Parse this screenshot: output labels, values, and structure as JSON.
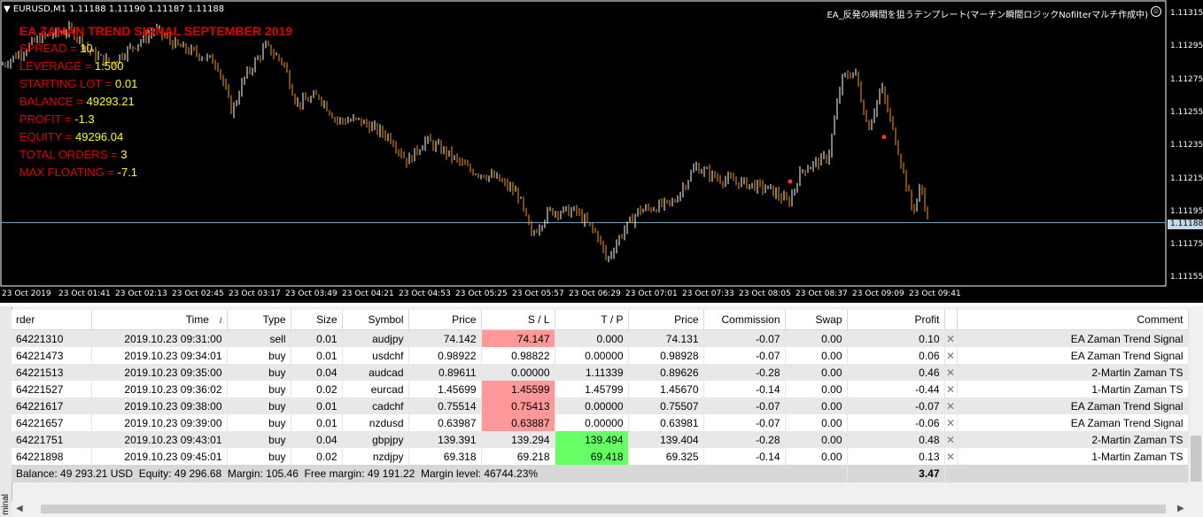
{
  "chart": {
    "symbol": "EURUSD,M1",
    "ohlc": "1.11188 1.11190 1.11187 1.11188",
    "expert_name": "EA_反発の瞬間を狙うテンプレート(マーチン瞬間ロジックNofilterマルチ作成中)",
    "expert_icon": "smiley-icon",
    "info_title": "EA ZAMAN TREND SIGNAL SEPTEMBER 2019",
    "info": [
      {
        "label": "SPREAD = ",
        "value": "10"
      },
      {
        "label": "LEVERAGE = ",
        "value": "1:500"
      },
      {
        "label": "STARTING LOT = ",
        "value": "0.01"
      },
      {
        "label": "BALANCE = ",
        "value": "49293.21"
      },
      {
        "label": "PROFIT = ",
        "value": "-1.3"
      },
      {
        "label": "EQUITY = ",
        "value": "49296.04"
      },
      {
        "label": "TOTAL ORDERS = ",
        "value": "3"
      },
      {
        "label": "MAX FLOATING = ",
        "value": "-7.1"
      }
    ],
    "price_labels": [
      "1.11315",
      "1.11295",
      "1.11275",
      "1.11255",
      "1.11235",
      "1.11215",
      "1.11195",
      "1.11175",
      "1.11155"
    ],
    "current_price": "1.11188",
    "time_labels": [
      "23 Oct 2019",
      "23 Oct 01:41",
      "23 Oct 02:13",
      "23 Oct 02:45",
      "23 Oct 03:17",
      "23 Oct 03:49",
      "23 Oct 04:21",
      "23 Oct 04:53",
      "23 Oct 05:25",
      "23 Oct 05:57",
      "23 Oct 06:29",
      "23 Oct 07:01",
      "23 Oct 07:33",
      "23 Oct 08:05",
      "23 Oct 08:37",
      "23 Oct 09:09",
      "23 Oct 09:41"
    ],
    "colors": {
      "bull": "#ffffff",
      "bear": "#ff9900",
      "info_label": "#e00000",
      "info_value": "#ffff00"
    }
  },
  "terminal": {
    "tab_label": "minal",
    "columns": [
      "rder",
      "Time",
      "Type",
      "Size",
      "Symbol",
      "Price",
      "S / L",
      "T / P",
      "Price",
      "Commission",
      "Swap",
      "Profit",
      "",
      "Comment"
    ],
    "sort_indicator": "/",
    "rows": [
      {
        "order": "64221310",
        "time": "2019.10.23 09:31:00",
        "type": "sell",
        "size": "0.01",
        "symbol": "audjpy",
        "price": "74.142",
        "sl": "74.147",
        "tp": "0.000",
        "cur": "74.131",
        "commission": "-0.07",
        "swap": "0.00",
        "profit": "0.10",
        "comment": "EA Zaman Trend Signal",
        "sl_hl": "red",
        "tp_hl": ""
      },
      {
        "order": "64221473",
        "time": "2019.10.23 09:34:01",
        "type": "buy",
        "size": "0.01",
        "symbol": "usdchf",
        "price": "0.98922",
        "sl": "0.98822",
        "tp": "0.00000",
        "cur": "0.98928",
        "commission": "-0.07",
        "swap": "0.00",
        "profit": "0.06",
        "comment": "EA Zaman Trend Signal",
        "sl_hl": "",
        "tp_hl": ""
      },
      {
        "order": "64221513",
        "time": "2019.10.23 09:35:00",
        "type": "buy",
        "size": "0.04",
        "symbol": "audcad",
        "price": "0.89611",
        "sl": "0.00000",
        "tp": "1.11339",
        "cur": "0.89626",
        "commission": "-0.28",
        "swap": "0.00",
        "profit": "0.46",
        "comment": "2-Martin Zaman TS",
        "sl_hl": "",
        "tp_hl": ""
      },
      {
        "order": "64221527",
        "time": "2019.10.23 09:36:02",
        "type": "buy",
        "size": "0.02",
        "symbol": "eurcad",
        "price": "1.45699",
        "sl": "1.45599",
        "tp": "1.45799",
        "cur": "1.45670",
        "commission": "-0.14",
        "swap": "0.00",
        "profit": "-0.44",
        "comment": "1-Martin Zaman TS",
        "sl_hl": "red",
        "tp_hl": ""
      },
      {
        "order": "64221617",
        "time": "2019.10.23 09:38:00",
        "type": "buy",
        "size": "0.01",
        "symbol": "cadchf",
        "price": "0.75514",
        "sl": "0.75413",
        "tp": "0.00000",
        "cur": "0.75507",
        "commission": "-0.07",
        "swap": "0.00",
        "profit": "-0.07",
        "comment": "EA Zaman Trend Signal",
        "sl_hl": "red",
        "tp_hl": ""
      },
      {
        "order": "64221657",
        "time": "2019.10.23 09:39:00",
        "type": "buy",
        "size": "0.01",
        "symbol": "nzdusd",
        "price": "0.63987",
        "sl": "0.63887",
        "tp": "0.00000",
        "cur": "0.63981",
        "commission": "-0.07",
        "swap": "0.00",
        "profit": "-0.06",
        "comment": "EA Zaman Trend Signal",
        "sl_hl": "red",
        "tp_hl": ""
      },
      {
        "order": "64221751",
        "time": "2019.10.23 09:43:01",
        "type": "buy",
        "size": "0.04",
        "symbol": "gbpjpy",
        "price": "139.391",
        "sl": "139.294",
        "tp": "139.494",
        "cur": "139.404",
        "commission": "-0.28",
        "swap": "0.00",
        "profit": "0.48",
        "comment": "2-Martin Zaman TS",
        "sl_hl": "",
        "tp_hl": "green"
      },
      {
        "order": "64221898",
        "time": "2019.10.23 09:45:01",
        "type": "buy",
        "size": "0.02",
        "symbol": "nzdjpy",
        "price": "69.318",
        "sl": "69.218",
        "tp": "69.418",
        "cur": "69.325",
        "commission": "-0.14",
        "swap": "0.00",
        "profit": "0.13",
        "comment": "1-Martin Zaman TS",
        "sl_hl": "",
        "tp_hl": "green"
      }
    ],
    "close_glyph": "✕",
    "summary": "Balance: 49 293.21 USD  Equity: 49 296.68  Margin: 105.46  Free margin: 49 191.22  Margin level: 46744.23%",
    "summary_profit": "3.47"
  }
}
